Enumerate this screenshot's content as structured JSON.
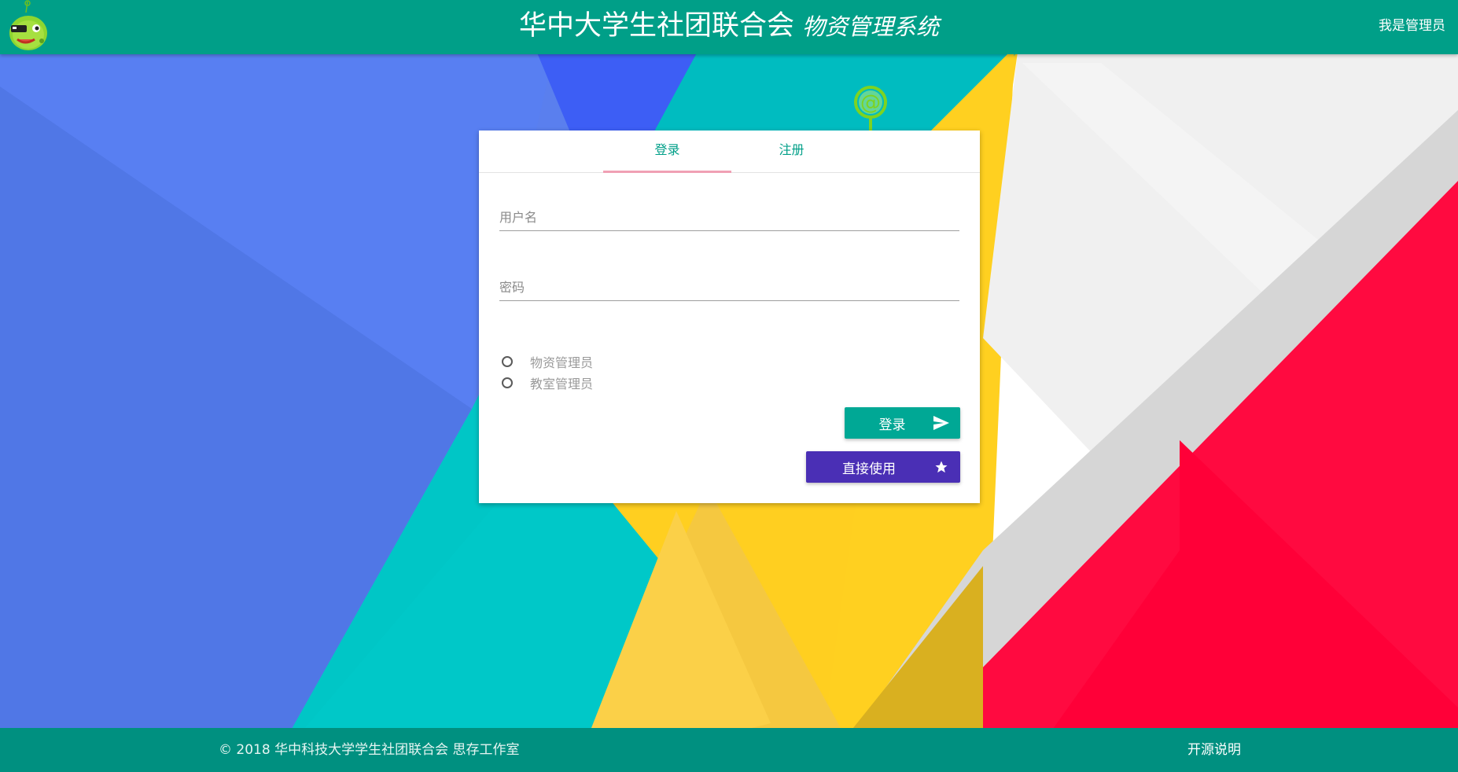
{
  "header": {
    "title": "华中大学生社团联合会",
    "subtitle": "物资管理系统",
    "user_link": "我是管理员",
    "logo_icon": "alien-mascot-icon"
  },
  "login_card": {
    "tabs": [
      {
        "label": "登录",
        "active": true
      },
      {
        "label": "注册",
        "active": false
      }
    ],
    "username_placeholder": "用户名",
    "password_placeholder": "密码",
    "roles": [
      {
        "label": "物资管理员",
        "selected": false
      },
      {
        "label": "教室管理员",
        "selected": false
      }
    ],
    "login_button": {
      "label": "登录",
      "icon": "send-icon"
    },
    "direct_button": {
      "label": "直接使用",
      "icon": "star-icon"
    },
    "mascot_icon": "at-sign-mascot-icon"
  },
  "footer": {
    "copyright": "© 2018 华中科技大学学生社团联合会 思存工作室",
    "opensource_link": "开源说明"
  },
  "colors": {
    "primary": "#009f88",
    "footer": "#009080",
    "tab_indicator": "#f0a0b4",
    "login_button": "#00a895",
    "direct_button": "#4a2fb5",
    "bg_blue": "#5a7fee",
    "bg_teal": "#00c4c4",
    "bg_yellow": "#ffcc20",
    "bg_red": "#ff0040"
  }
}
